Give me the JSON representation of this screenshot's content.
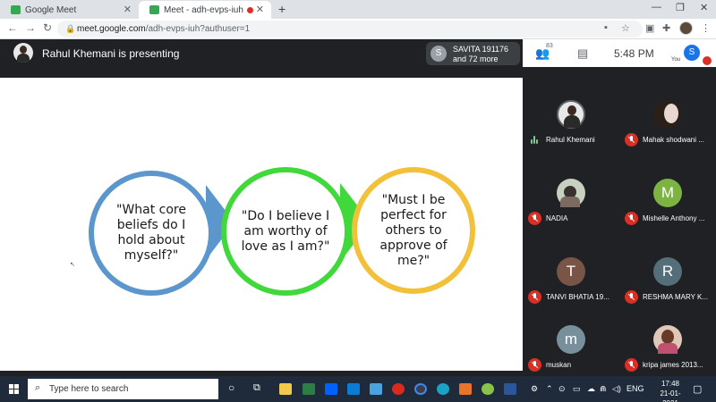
{
  "browser": {
    "tabs": [
      {
        "title": "Google Meet",
        "active": false
      },
      {
        "title": "Meet - adh-evps-iuh",
        "active": true
      }
    ],
    "url_domain": "meet.google.com",
    "url_path": "/adh-evps-iuh?authuser=1"
  },
  "meet": {
    "presenting_text": "Rahul Khemani is presenting",
    "others_avatar_letter": "S",
    "others_line1": "SAVITA 191176",
    "others_line2": "and 72 more",
    "people_count": "83",
    "time": "5:48  PM",
    "you_letter": "S",
    "you_label": "You"
  },
  "slide": {
    "bubble1": "\"What core beliefs do I hold about myself?\"",
    "bubble2": "\"Do I believe I am worthy of love as I am?\"",
    "bubble3": "\"Must I be perfect for others to approve of me?\"",
    "colors": {
      "bubble1": "#5b96cc",
      "bubble2": "#40d83a",
      "bubble3": "#f3c03a"
    }
  },
  "participants": [
    {
      "name": "Rahul Khemani",
      "letter": "",
      "color": "#e8e8e8",
      "muted": false,
      "photo": true
    },
    {
      "name": "Mahak shodwani ...",
      "letter": "",
      "color": "#e9d7d2",
      "muted": true,
      "photo": true
    },
    {
      "name": "NADIA",
      "letter": "",
      "color": "#c8d0c0",
      "muted": true,
      "photo": true
    },
    {
      "name": "Mishelle Anthony ...",
      "letter": "M",
      "color": "#7cb342",
      "muted": true,
      "photo": false
    },
    {
      "name": "TANVI BHATIA 19...",
      "letter": "T",
      "color": "#795548",
      "muted": true,
      "photo": false
    },
    {
      "name": "RESHMA MARY K...",
      "letter": "R",
      "color": "#546e7a",
      "muted": true,
      "photo": false
    },
    {
      "name": "muskan",
      "letter": "m",
      "color": "#78909c",
      "muted": true,
      "photo": false
    },
    {
      "name": "kripa james 2013...",
      "letter": "",
      "color": "#e0c8b8",
      "muted": true,
      "photo": true
    }
  ],
  "taskbar": {
    "search_placeholder": "Type here to search",
    "lang": "ENG",
    "time": "17:48",
    "date": "21-01-2021"
  }
}
